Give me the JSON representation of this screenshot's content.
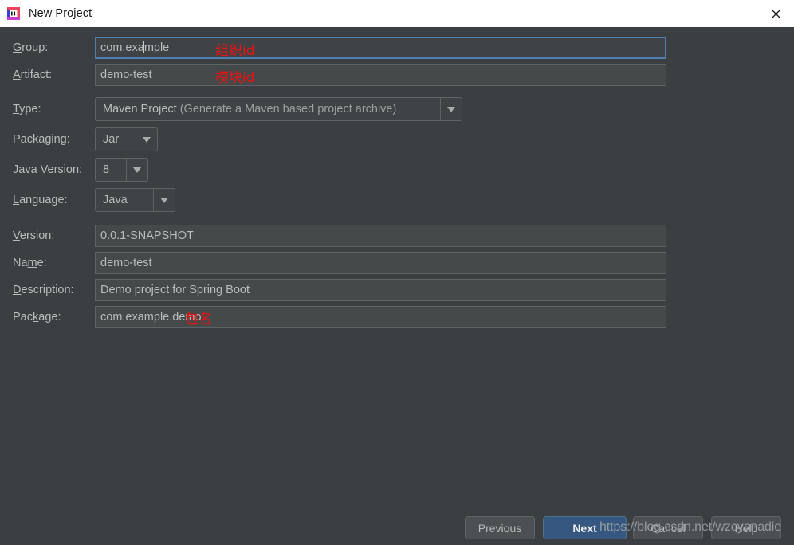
{
  "window": {
    "title": "New Project",
    "icon": "intellij-idea-icon",
    "close_icon": "close-icon"
  },
  "form": {
    "rows": [
      {
        "id": "group",
        "label": "Group:",
        "mnemonic": "G",
        "type": "text",
        "value": "com.example",
        "focused": true,
        "caret_after": "com.exa",
        "annotation": "组织id"
      },
      {
        "id": "artifact",
        "label": "Artifact:",
        "mnemonic": "A",
        "type": "text",
        "value": "demo-test",
        "focused": false,
        "annotation": "模块id"
      },
      {
        "id": "type",
        "label": "Type:",
        "mnemonic": "T",
        "type": "combo",
        "value": "Maven Project",
        "value_dim": " (Generate a Maven based project archive)",
        "arrow_icon": "chevron-down-icon"
      },
      {
        "id": "packaging",
        "label": "Packaging:",
        "mnemonic": "g",
        "type": "combo",
        "value": "Jar",
        "arrow_icon": "chevron-down-icon"
      },
      {
        "id": "java-version",
        "label": "Java Version:",
        "mnemonic": "J",
        "type": "combo",
        "value": "8",
        "arrow_icon": "chevron-down-icon"
      },
      {
        "id": "language",
        "label": "Language:",
        "mnemonic": "L",
        "type": "combo",
        "value": "Java",
        "arrow_icon": "chevron-down-icon"
      },
      {
        "id": "version",
        "label": "Version:",
        "mnemonic": "V",
        "type": "text",
        "value": "0.0.1-SNAPSHOT",
        "focused": false
      },
      {
        "id": "name",
        "label": "Name:",
        "mnemonic": "m",
        "type": "text",
        "value": "demo-test",
        "focused": false
      },
      {
        "id": "description",
        "label": "Description:",
        "mnemonic": "D",
        "type": "text",
        "value": "Demo project for Spring Boot",
        "focused": false
      },
      {
        "id": "package",
        "label": "Package:",
        "mnemonic": "k",
        "type": "text",
        "value": "com.example.demo",
        "focused": false,
        "annotation": "包名"
      }
    ]
  },
  "buttons": {
    "previous": "Previous",
    "next": "Next",
    "cancel": "Cancel",
    "help": "Help"
  },
  "watermark": {
    "text": "https://blog.csdn.net/wzcyanadie"
  },
  "colors": {
    "background": "#3c3f41",
    "titlebar": "#ffffff",
    "field_bg": "#45494a",
    "field_border": "#5e6364",
    "focus_border": "#4b7fae",
    "text": "#b8bcbd",
    "primary_button": "#365880",
    "annotation_red": "#f01010"
  }
}
